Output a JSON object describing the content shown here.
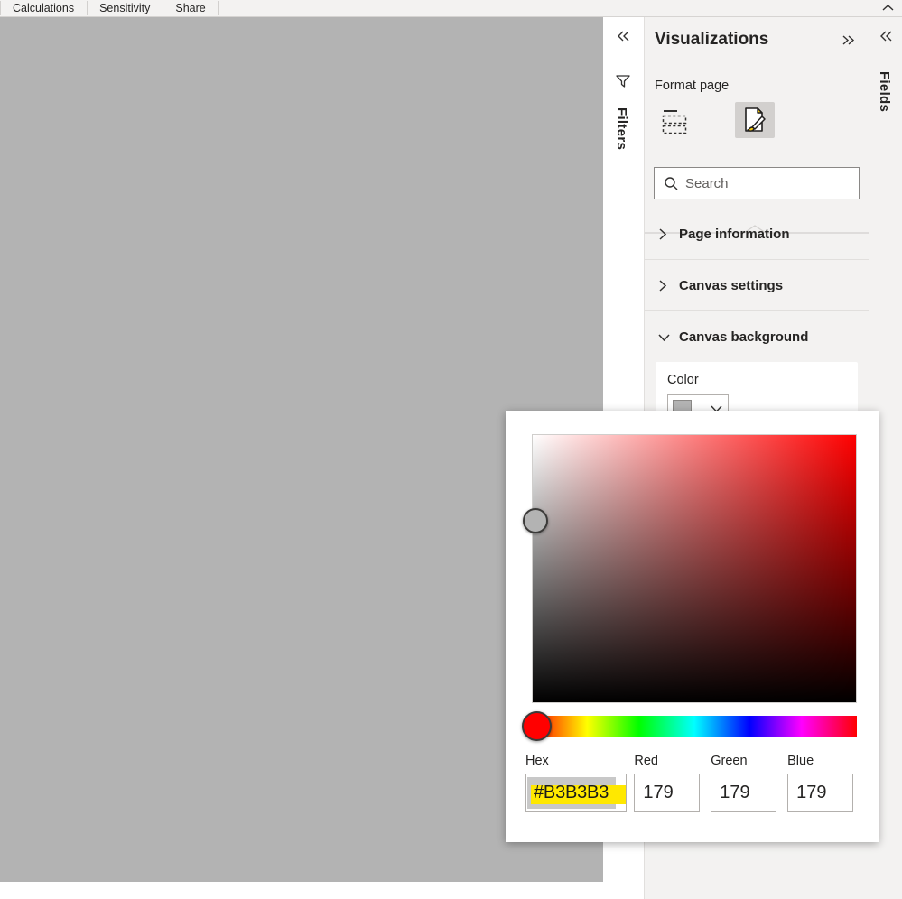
{
  "ribbon": {
    "groups": [
      {
        "label": "Calculations"
      },
      {
        "label": "Sensitivity"
      },
      {
        "label": "Share"
      }
    ],
    "collapse_icon": "chevron-up-icon"
  },
  "canvas": {
    "background_color": "#B3B3B3"
  },
  "filters_rail": {
    "collapse_icon": "chevron-double-left-icon",
    "filter_icon": "filter-funnel-icon",
    "label": "Filters"
  },
  "fields_rail": {
    "collapse_icon": "chevron-double-left-icon",
    "label": "Fields"
  },
  "visualizations": {
    "title": "Visualizations",
    "expand_icon": "chevron-double-right-icon",
    "subtitle": "Format page",
    "tabs": [
      {
        "name": "build-visual",
        "icon": "fields-placeholder-icon",
        "selected": false
      },
      {
        "name": "format-visual",
        "icon": "paintbrush-page-icon",
        "selected": true
      }
    ],
    "search": {
      "icon": "search-icon",
      "placeholder": "Search",
      "value": ""
    },
    "sections": [
      {
        "title": "Page information",
        "expanded": false,
        "chevron": "chevron-right-icon"
      },
      {
        "title": "Canvas settings",
        "expanded": false,
        "chevron": "chevron-right-icon"
      },
      {
        "title": "Canvas background",
        "expanded": true,
        "chevron": "chevron-down-icon"
      }
    ],
    "canvas_background": {
      "color_label": "Color",
      "color_value": "#B3B3B3",
      "dropdown_icon": "chevron-down-icon"
    }
  },
  "color_picker": {
    "current_color": "#B3B3B3",
    "hue_thumb_color": "#FF0000",
    "sv_thumb_color": "#B3B3B3",
    "gradient_start": "#FFFFFF",
    "gradient_end": "#FF0000",
    "fields": {
      "hex": {
        "label": "Hex",
        "value": "#B3B3B3",
        "selected": true,
        "highlight_color": "#FFE800"
      },
      "red": {
        "label": "Red",
        "value": "179"
      },
      "green": {
        "label": "Green",
        "value": "179"
      },
      "blue": {
        "label": "Blue",
        "value": "179"
      }
    }
  }
}
